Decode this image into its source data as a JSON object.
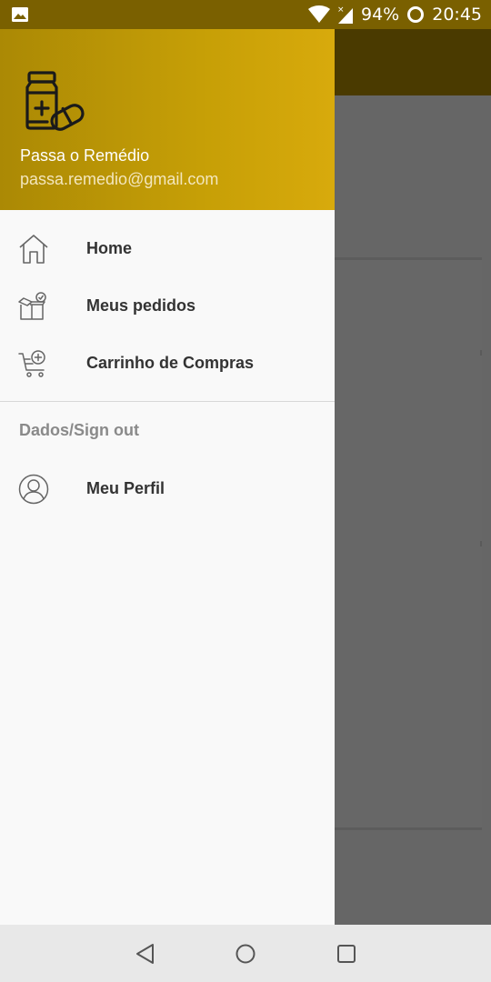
{
  "status_bar": {
    "battery_percent": "94%",
    "time": "20:45",
    "icons": [
      "image-icon",
      "wifi-icon",
      "signal-icon",
      "battery-ring-icon"
    ]
  },
  "drawer": {
    "header": {
      "app_name": "Passa o Remédio",
      "email": "passa.remedio@gmail.com",
      "logo_icon": "medicine-bottle-pills-icon",
      "gradient": [
        "#ab8905",
        "#d8aa0c"
      ]
    },
    "items": [
      {
        "label": "Home",
        "icon": "home-icon"
      },
      {
        "label": "Meus pedidos",
        "icon": "orders-box-icon"
      },
      {
        "label": "Carrinho de Compras",
        "icon": "shopping-cart-icon"
      }
    ],
    "section": {
      "title": "Dados/Sign out",
      "items": [
        {
          "label": "Meu Perfil",
          "icon": "profile-icon"
        }
      ]
    }
  },
  "nav_bar": {
    "buttons": [
      "back-icon",
      "home-circle-icon",
      "recents-icon"
    ]
  },
  "colors": {
    "status_bar": "#7a6000",
    "scrim": "#646464",
    "drawer_bg": "#f9f9f9",
    "label_text": "#333333",
    "section_text": "#8a8a8a"
  }
}
